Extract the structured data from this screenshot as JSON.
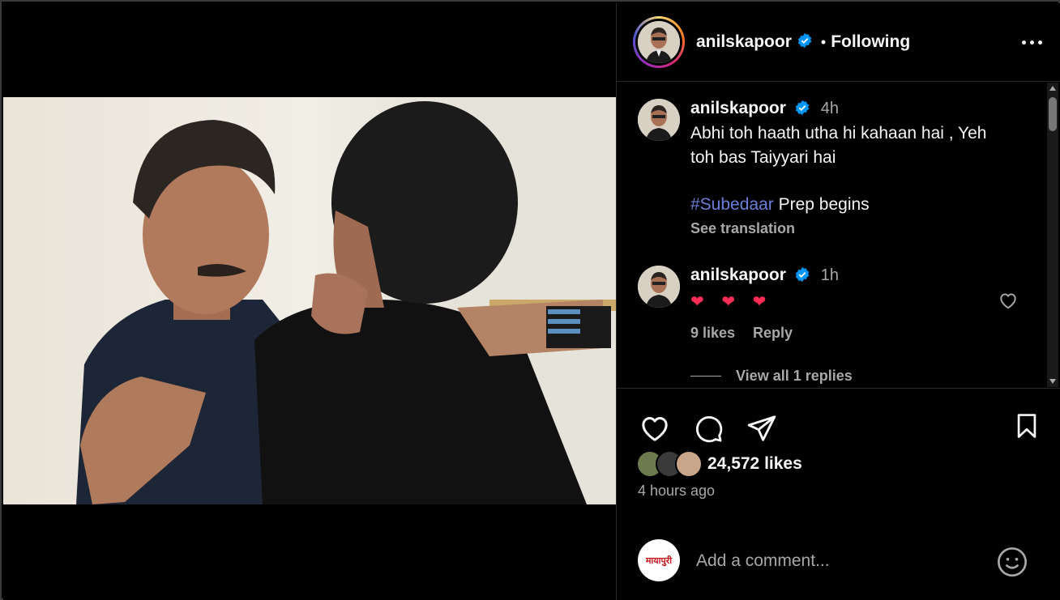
{
  "post": {
    "username": "anilskapoor",
    "follow_state": "Following",
    "dot": "•",
    "caption_line1": "Abhi toh haath utha hi kahaan hai , Yeh",
    "caption_line2": "toh bas Taiyyari hai",
    "hashtag": "#Subedaar",
    "caption_tail": " Prep begins",
    "caption_time": "4h",
    "see_translation": "See translation",
    "likes": "24,572 likes",
    "posted_ago": "4 hours ago"
  },
  "comments": [
    {
      "username": "anilskapoor",
      "time": "1h",
      "text": "❤ ❤ ❤",
      "likes": "9 likes",
      "reply_label": "Reply",
      "view_replies": "View all 1 replies"
    }
  ],
  "composer": {
    "placeholder": "Add a comment...",
    "avatar_text": "मायापुरी"
  },
  "colors": {
    "background": "#000000",
    "text": "#f5f5f5",
    "muted": "#a8a8a8",
    "hashtag": "#6b7fd8",
    "verified": "#0095f6",
    "heart": "#ff2d55"
  },
  "icons": {
    "verified": "verified-badge-icon",
    "more": "more-options-icon",
    "like": "heart-icon",
    "comment": "comment-icon",
    "share": "send-icon",
    "save": "bookmark-icon",
    "tag": "user-tag-icon",
    "emoji": "emoji-icon"
  }
}
